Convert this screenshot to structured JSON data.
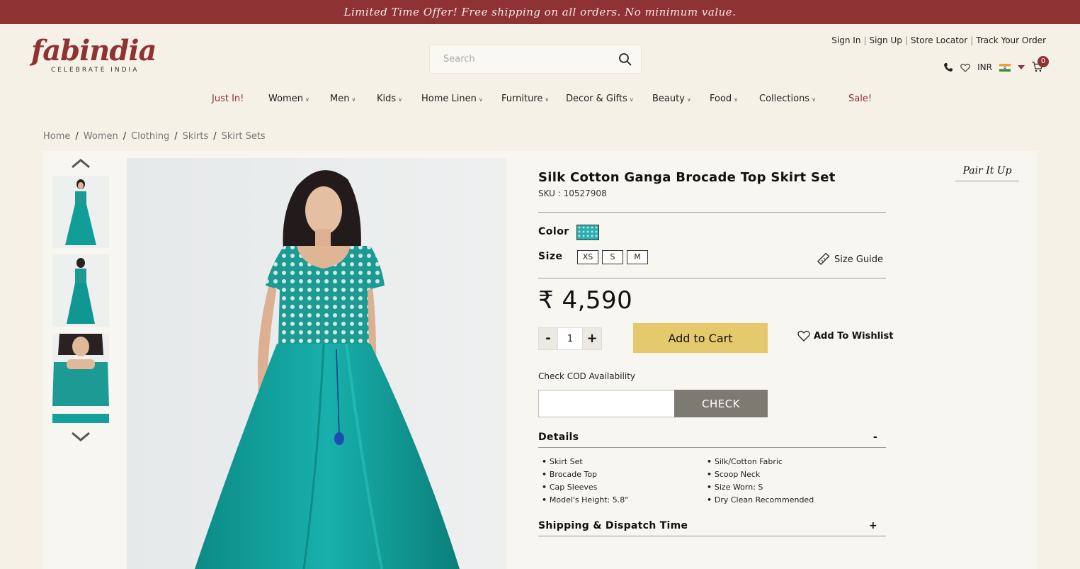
{
  "promo": {
    "text": "Limited Time Offer! Free shipping on all orders. No minimum value."
  },
  "logo": {
    "name": "fabindia",
    "tagline": "CELEBRATE INDIA"
  },
  "search": {
    "placeholder": "Search"
  },
  "top_links": [
    "Sign In",
    "Sign Up",
    "Store Locator",
    "Track Your Order"
  ],
  "utility": {
    "currency": "INR",
    "cart_count": "0"
  },
  "nav": [
    {
      "label": "Just In!",
      "highlight": true
    },
    {
      "label": "Women"
    },
    {
      "label": "Men"
    },
    {
      "label": "Kids"
    },
    {
      "label": "Home Linen"
    },
    {
      "label": "Furniture"
    },
    {
      "label": "Decor & Gifts"
    },
    {
      "label": "Beauty"
    },
    {
      "label": "Food"
    },
    {
      "label": "Collections"
    },
    {
      "label": "Sale!",
      "highlight": true
    }
  ],
  "breadcrumb": [
    "Home",
    "Women",
    "Clothing",
    "Skirts",
    "Skirt Sets"
  ],
  "product": {
    "title": "Silk Cotton Ganga Brocade Top Skirt Set",
    "sku": "SKU : 10527908",
    "color_label": "Color",
    "size_label": "Size",
    "sizes": [
      "XS",
      "S",
      "M"
    ],
    "size_guide": "Size Guide",
    "price": "₹ 4,590",
    "quantity": "1",
    "qty_minus": "-",
    "qty_plus": "+",
    "add_to_cart": "Add to Cart",
    "add_to_wishlist": "Add To Wishlist",
    "cod_label": "Check COD Availability",
    "cod_button": "CHECK",
    "details_title": "Details",
    "details_toggle": "-",
    "details_left": [
      "Skirt Set",
      "Brocade Top",
      "Cap Sleeves",
      "Model's Height: 5.8\""
    ],
    "details_right": [
      "Silk/Cotton Fabric",
      "Scoop Neck",
      "Size Worn: S",
      "Dry Clean Recommended"
    ],
    "shipping_title": "Shipping & Dispatch Time",
    "shipping_toggle": "+",
    "pair_it_up": "Pair It Up"
  },
  "colors": {
    "brand": "#8e3234",
    "cart_button": "#e5c96d",
    "check_button": "#7d7a72",
    "swatch": "#2fb0b0"
  }
}
